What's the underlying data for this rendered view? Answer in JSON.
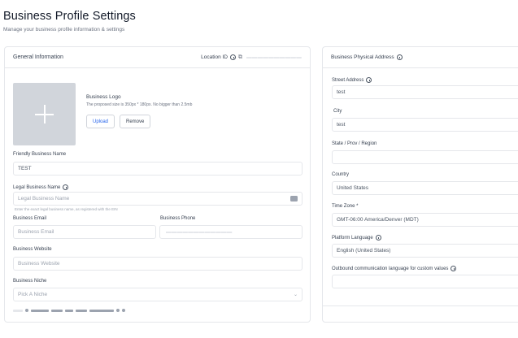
{
  "page": {
    "title": "Business Profile Settings",
    "subtitle": "Manage your business profile information & settings"
  },
  "general": {
    "title": "General Information",
    "location_label": "Location ID",
    "logo": {
      "label": "Business Logo",
      "hint": "The proposed size is 350px * 180px. No bigger than 2.5mb",
      "upload": "Upload",
      "remove": "Remove"
    },
    "friendly_name": {
      "label": "Friendly Business Name",
      "value": "TEST"
    },
    "legal_name": {
      "label": "Legal Business Name",
      "placeholder": "Legal Business Name",
      "hint": "Enter the exact legal business name, as registered with the EIN"
    },
    "email": {
      "label": "Business Email",
      "placeholder": "Business Email"
    },
    "phone": {
      "label": "Business Phone"
    },
    "website": {
      "label": "Business Website",
      "placeholder": "Business Website"
    },
    "niche": {
      "label": "Business Niche",
      "placeholder": "Pick A Niche"
    }
  },
  "address": {
    "title": "Business Physical Address",
    "street": {
      "label": "Street Address",
      "value": "test"
    },
    "city": {
      "label": "City",
      "value": "test"
    },
    "state": {
      "label": "State / Prov / Region",
      "value": ""
    },
    "country": {
      "label": "Country",
      "value": "United States"
    },
    "timezone": {
      "label": "Time Zone *",
      "value": "GMT-06:00 America/Denver (MDT)"
    },
    "platform_language": {
      "label": "Platform Language",
      "value": "English (United States)"
    },
    "outbound_language": {
      "label": "Outbound communication language for custom values",
      "value": ""
    }
  }
}
